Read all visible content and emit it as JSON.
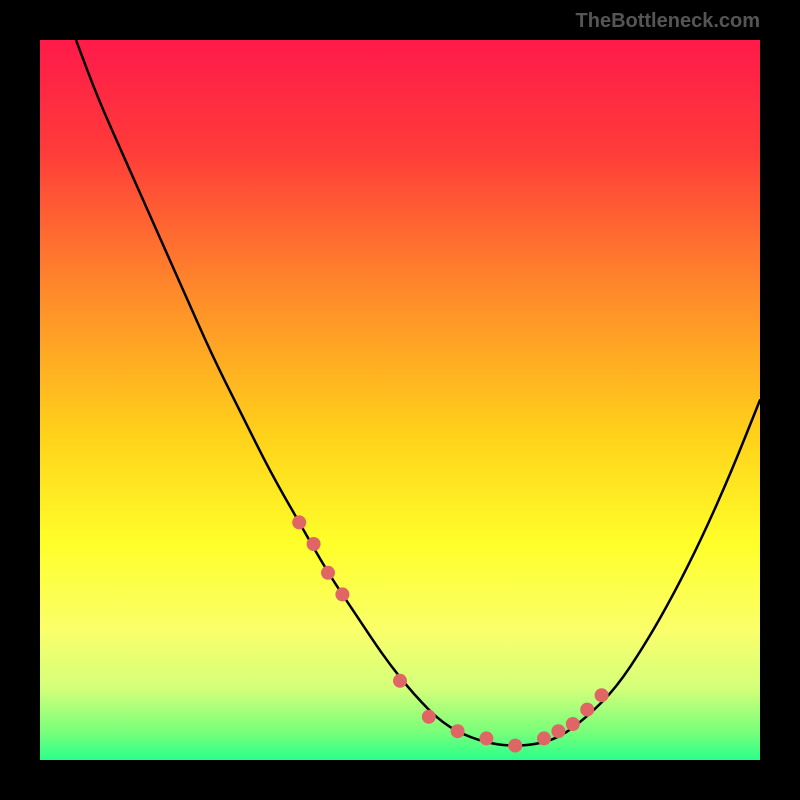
{
  "watermark": "TheBottleneck.com",
  "chart_data": {
    "type": "line",
    "title": "",
    "xlabel": "",
    "ylabel": "",
    "xlim": [
      0,
      100
    ],
    "ylim": [
      0,
      100
    ],
    "curve": {
      "name": "bottleneck-curve",
      "x": [
        5,
        8,
        12,
        16,
        20,
        24,
        28,
        32,
        36,
        40,
        44,
        48,
        52,
        56,
        60,
        64,
        68,
        72,
        76,
        80,
        84,
        88,
        92,
        96,
        100
      ],
      "y": [
        100,
        92,
        83,
        74,
        65,
        56,
        48,
        40,
        33,
        26,
        20,
        14,
        9,
        5,
        3,
        2,
        2,
        3,
        6,
        10,
        16,
        23,
        31,
        40,
        50
      ]
    },
    "markers": {
      "name": "highlight-points",
      "color": "#e06666",
      "x": [
        36,
        38,
        40,
        42,
        50,
        54,
        58,
        62,
        66,
        70,
        72,
        74,
        76,
        78
      ],
      "y": [
        33,
        30,
        26,
        23,
        11,
        6,
        4,
        3,
        2,
        3,
        4,
        5,
        7,
        9
      ]
    },
    "gradient_stops": [
      {
        "offset": 0,
        "color": "#ff1a4a"
      },
      {
        "offset": 0.15,
        "color": "#ff3a3a"
      },
      {
        "offset": 0.35,
        "color": "#ff8a2a"
      },
      {
        "offset": 0.55,
        "color": "#ffd21a"
      },
      {
        "offset": 0.7,
        "color": "#ffff2a"
      },
      {
        "offset": 0.82,
        "color": "#faff6a"
      },
      {
        "offset": 0.9,
        "color": "#d4ff7a"
      },
      {
        "offset": 0.96,
        "color": "#7aff7a"
      },
      {
        "offset": 1.0,
        "color": "#2aff8a"
      }
    ]
  }
}
